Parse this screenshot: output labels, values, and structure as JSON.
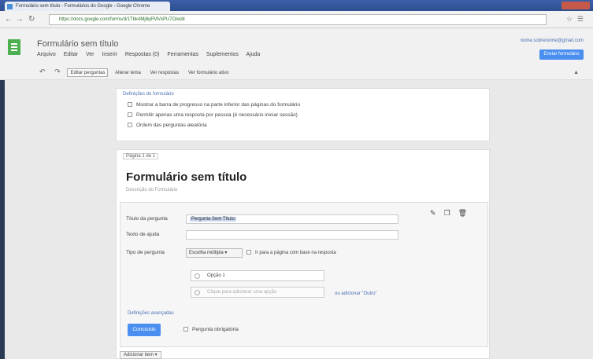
{
  "browser": {
    "tab_title": "Formulário sem título - Formulários do Google - Google Chrome",
    "url": "https://docs.google.com/forms/d/1Tbk4Mj8qFMVxPU7O/edit"
  },
  "app": {
    "doc_title": "Formulário sem título",
    "account": "nome.sobrenome@gmail.com",
    "view_button": "Enviar formulário",
    "menu": [
      "Arquivo",
      "Editar",
      "Ver",
      "Inserir",
      "Respostas (0)",
      "Ferramentas",
      "Suplementos",
      "Ajuda"
    ]
  },
  "toolbar": {
    "edit_questions": "Editar perguntas",
    "change_theme": "Alterar tema",
    "responses": "Ver respostas",
    "live_form": "Ver formulário ativo"
  },
  "settings": {
    "title": "Definições do formulário",
    "options": [
      "Mostrar a barra de progresso na parte inferior das páginas do formulário",
      "Permitir apenas uma resposta por pessoa (é necessário iniciar sessão)",
      "Ordem das perguntas aleatória"
    ]
  },
  "page": {
    "label": "Página 1 de 1",
    "form_title": "Formulário sem título",
    "form_desc": "Descrição do Formulário"
  },
  "question": {
    "title_label": "Título da pergunta",
    "title_value": "Pergunta Sem Título",
    "help_label": "Texto de ajuda",
    "type_label": "Tipo de pergunta",
    "type_value": "Escolha múltipla",
    "go_to_page": "Ir para a página com base na resposta",
    "option1": "Opção 1",
    "option_placeholder": "Clique para adicionar uma opção",
    "add_other": "ou adicionar \"Outro\"",
    "advanced": "Definições avançadas",
    "done": "Concluído",
    "required": "Pergunta obrigatória"
  },
  "footer": {
    "add_item": "Adicionar item"
  }
}
